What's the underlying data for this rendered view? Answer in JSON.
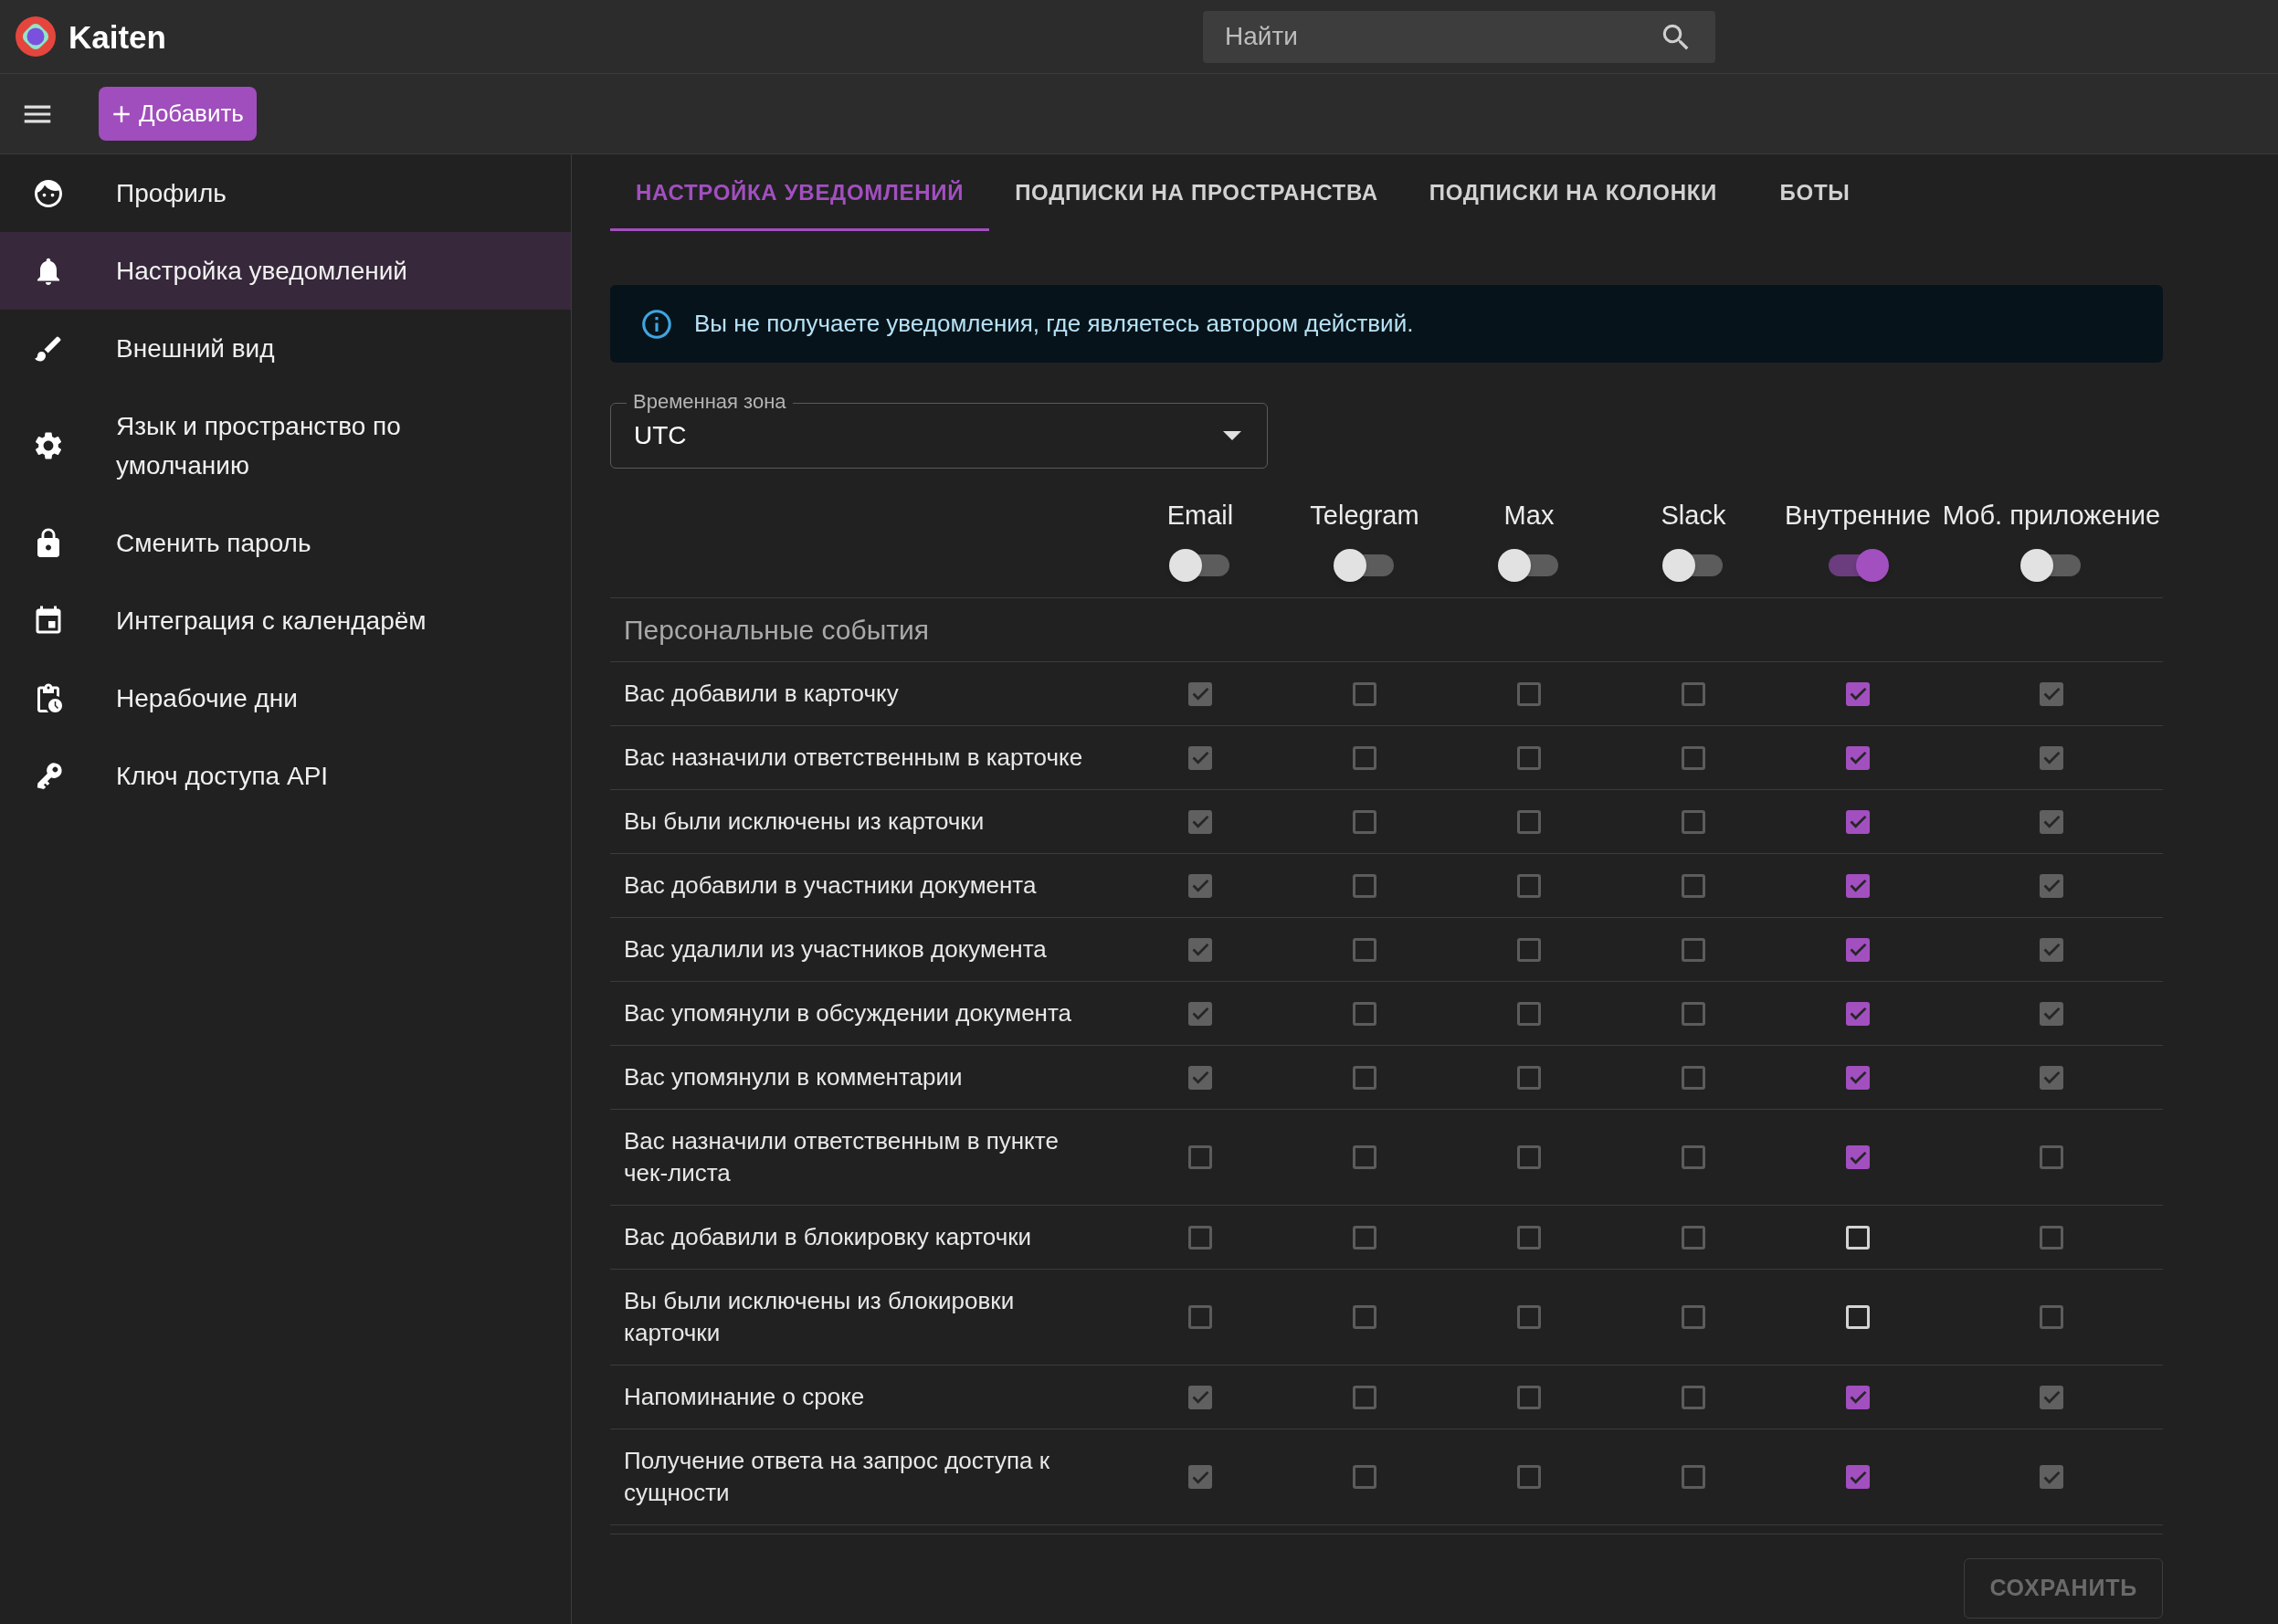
{
  "app": {
    "name": "Kaiten"
  },
  "search": {
    "placeholder": "Найти"
  },
  "toolbar": {
    "add_button": "Добавить"
  },
  "sidebar": {
    "items": [
      {
        "label": "Профиль",
        "selected": false
      },
      {
        "label": "Настройка уведомлений",
        "selected": true
      },
      {
        "label": "Внешний вид",
        "selected": false
      },
      {
        "label": "Язык и пространство по умолчанию",
        "selected": false
      },
      {
        "label": "Сменить пароль",
        "selected": false
      },
      {
        "label": "Интеграция с календарём",
        "selected": false
      },
      {
        "label": "Нерабочие дни",
        "selected": false
      },
      {
        "label": "Ключ доступа API",
        "selected": false
      }
    ]
  },
  "tabs": [
    {
      "label": "НАСТРОЙКА УВЕДОМЛЕНИЙ",
      "selected": true
    },
    {
      "label": "ПОДПИСКИ НА ПРОСТРАНСТВА",
      "selected": false
    },
    {
      "label": "ПОДПИСКИ НА КОЛОНКИ",
      "selected": false
    },
    {
      "label": "БОТЫ",
      "selected": false
    }
  ],
  "info_banner": {
    "text": "Вы не получаете уведомления, где являетесь автором действий."
  },
  "timezone": {
    "label": "Временная зона",
    "value": "UTC"
  },
  "channels": [
    {
      "name": "Email",
      "on": false
    },
    {
      "name": "Telegram",
      "on": false
    },
    {
      "name": "Max",
      "on": false
    },
    {
      "name": "Slack",
      "on": false
    },
    {
      "name": "Внутренние",
      "on": true
    },
    {
      "name": "Моб. приложение",
      "on": false
    }
  ],
  "sections": [
    {
      "title": "Персональные события",
      "rows": [
        {
          "label": "Вас добавили в карточку",
          "checks": [
            true,
            false,
            false,
            false,
            true,
            true
          ]
        },
        {
          "label": "Вас назначили ответственным в карточке",
          "checks": [
            true,
            false,
            false,
            false,
            true,
            true
          ]
        },
        {
          "label": "Вы были исключены из карточки",
          "checks": [
            true,
            false,
            false,
            false,
            true,
            true
          ]
        },
        {
          "label": "Вас добавили в участники документа",
          "checks": [
            true,
            false,
            false,
            false,
            true,
            true
          ]
        },
        {
          "label": "Вас удалили из участников документа",
          "checks": [
            true,
            false,
            false,
            false,
            true,
            true
          ]
        },
        {
          "label": "Вас упомянули в обсуждении документа",
          "checks": [
            true,
            false,
            false,
            false,
            true,
            true
          ]
        },
        {
          "label": "Вас упомянули в комментарии",
          "checks": [
            true,
            false,
            false,
            false,
            true,
            true
          ]
        },
        {
          "label": "Вас назначили ответственным в пункте чек-листа",
          "checks": [
            false,
            false,
            false,
            false,
            true,
            false
          ]
        },
        {
          "label": "Вас добавили в блокировку карточки",
          "checks": [
            false,
            false,
            false,
            false,
            false,
            false
          ]
        },
        {
          "label": "Вы были исключены из блокировки карточки",
          "checks": [
            false,
            false,
            false,
            false,
            false,
            false
          ]
        },
        {
          "label": "Напоминание о сроке",
          "checks": [
            true,
            false,
            false,
            false,
            true,
            true
          ]
        },
        {
          "label": "Получение ответа на запрос доступа к сущности",
          "checks": [
            true,
            false,
            false,
            false,
            true,
            true
          ]
        }
      ]
    }
  ],
  "save_button": {
    "label": "СОХРАНИТЬ",
    "disabled": true
  }
}
